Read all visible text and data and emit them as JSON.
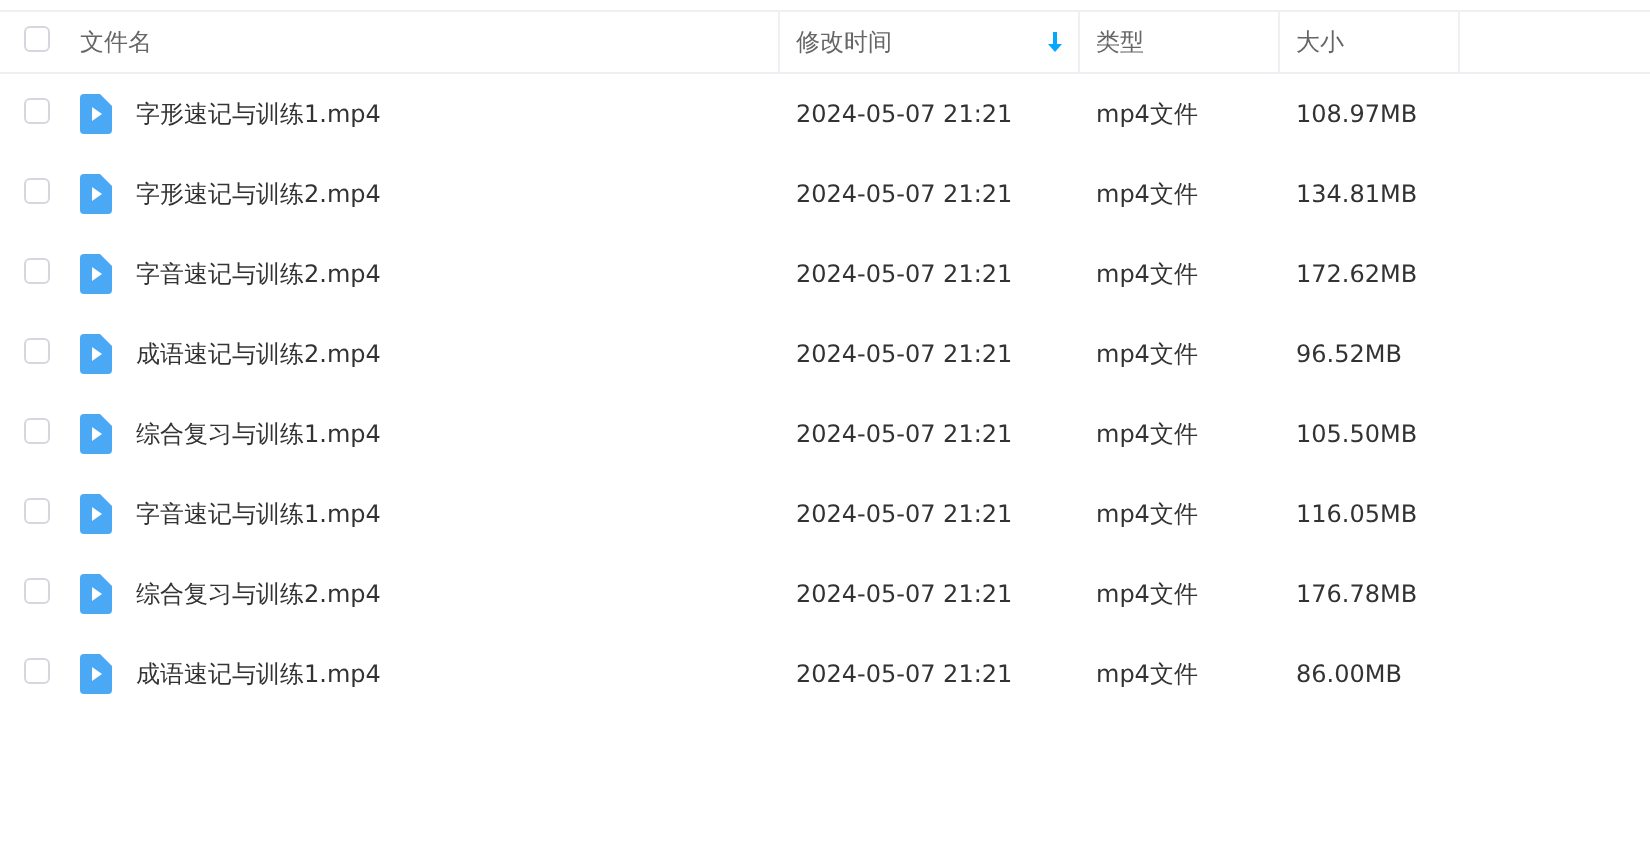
{
  "table": {
    "select_all": {
      "checked": false
    },
    "columns": [
      {
        "label": "文件名",
        "sorted": false
      },
      {
        "label": "修改时间",
        "sorted": true
      },
      {
        "label": "类型",
        "sorted": false
      },
      {
        "label": "大小",
        "sorted": false
      }
    ],
    "rows": [
      {
        "checked": false,
        "name": "字形速记与训练1.mp4",
        "modified": "2024-05-07 21:21",
        "type": "mp4文件",
        "size": "108.97MB"
      },
      {
        "checked": false,
        "name": "字形速记与训练2.mp4",
        "modified": "2024-05-07 21:21",
        "type": "mp4文件",
        "size": "134.81MB"
      },
      {
        "checked": false,
        "name": "字音速记与训练2.mp4",
        "modified": "2024-05-07 21:21",
        "type": "mp4文件",
        "size": "172.62MB"
      },
      {
        "checked": false,
        "name": "成语速记与训练2.mp4",
        "modified": "2024-05-07 21:21",
        "type": "mp4文件",
        "size": "96.52MB"
      },
      {
        "checked": false,
        "name": "综合复习与训练1.mp4",
        "modified": "2024-05-07 21:21",
        "type": "mp4文件",
        "size": "105.50MB"
      },
      {
        "checked": false,
        "name": "字音速记与训练1.mp4",
        "modified": "2024-05-07 21:21",
        "type": "mp4文件",
        "size": "116.05MB"
      },
      {
        "checked": false,
        "name": "综合复习与训练2.mp4",
        "modified": "2024-05-07 21:21",
        "type": "mp4文件",
        "size": "176.78MB"
      },
      {
        "checked": false,
        "name": "成语速记与训练1.mp4",
        "modified": "2024-05-07 21:21",
        "type": "mp4文件",
        "size": "86.00MB"
      }
    ]
  }
}
